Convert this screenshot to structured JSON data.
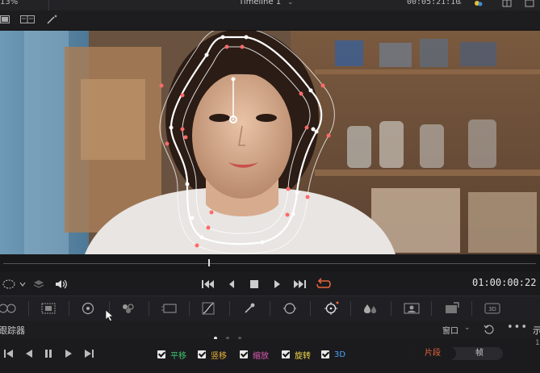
{
  "topbar": {
    "zoom": "13%",
    "timeline_title": "Timeline 1",
    "timecode": "00:05:21:10"
  },
  "transport": {
    "timecode": "01:00:00:22"
  },
  "tracker": {
    "title": "跟踪器",
    "window_label": "窗口",
    "right_cut": "示",
    "checkboxes": [
      {
        "label": "平移",
        "color": "#3ec46d"
      },
      {
        "label": "竖移",
        "color": "#e7b43a"
      },
      {
        "label": "缩放",
        "color": "#e05bb6"
      },
      {
        "label": "旋转",
        "color": "#f2d84a"
      },
      {
        "label": "3D",
        "color": "#4aa3ff"
      }
    ],
    "modes": [
      "片段",
      "帧"
    ],
    "edge_value": "1"
  },
  "icons": {
    "toolbar": [
      "single-viewer-icon",
      "dual-viewer-icon",
      "magic-wand-icon"
    ],
    "transport": [
      "window-shape-icon",
      "layers-icon",
      "speaker-icon",
      "go-to-start-icon",
      "step-back-icon",
      "stop-icon",
      "play-icon",
      "go-to-end-icon",
      "loop-icon"
    ],
    "palette": [
      "camera-raw-icon",
      "color-match-icon",
      "color-wheels-icon",
      "rgb-mixer-icon",
      "motion-effects-icon",
      "curves-icon",
      "qualifier-icon",
      "window-icon",
      "tracker-icon",
      "blur-icon",
      "key-icon",
      "sizing-icon",
      "3d-icon"
    ],
    "tracker": [
      "track-back-icon",
      "step-back-icon",
      "pause-icon",
      "play-icon",
      "track-forward-icon",
      "reset-icon",
      "more-icon"
    ]
  },
  "colors": {
    "accent": "#e8643c",
    "window_outline": "#ffffff",
    "control_point": "#ff5a5a"
  }
}
